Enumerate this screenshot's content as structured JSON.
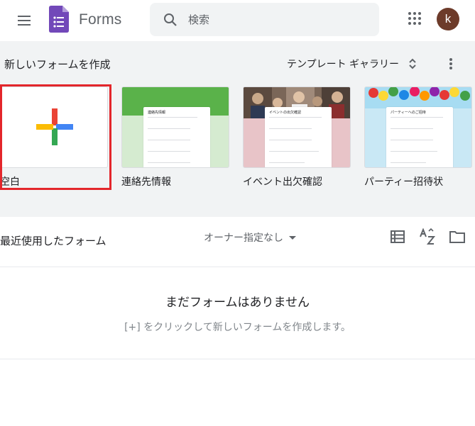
{
  "header": {
    "app_title": "Forms",
    "search_placeholder": "検索",
    "avatar_letter": "k"
  },
  "new_form": {
    "title": "新しいフォームを作成",
    "gallery_label": "テンプレート ギャラリー",
    "templates": [
      {
        "label": "空白",
        "selected": true
      },
      {
        "label": "連絡先情報",
        "thumb_title": "連絡先情報"
      },
      {
        "label": "イベント出欠確認",
        "thumb_title": "イベントの出欠確認"
      },
      {
        "label": "パーティー招待状",
        "thumb_title": "パーティーへのご招待"
      }
    ]
  },
  "recent": {
    "title": "最近使用したフォーム",
    "owner_filter": "オーナー指定なし",
    "empty_title": "まだフォームはありません",
    "empty_hint": "[+] をクリックして新しいフォームを作成します。"
  },
  "colors": {
    "highlight": "#e3262b",
    "forms_purple": "#7248b9",
    "google_blue": "#4285f4",
    "google_red": "#ea4335",
    "google_yellow": "#fbbc04",
    "google_green": "#34a853",
    "avatar_bg": "#6d3b2a"
  }
}
